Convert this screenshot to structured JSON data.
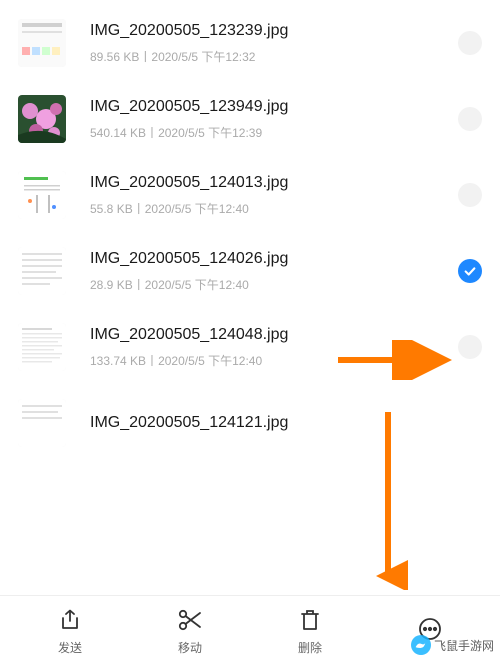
{
  "files": [
    {
      "name": "IMG_20200505_123239.jpg",
      "size": "89.56 KB",
      "date": "2020/5/5 下午12:32",
      "selected": false,
      "thumb": "doc1"
    },
    {
      "name": "IMG_20200505_123949.jpg",
      "size": "540.14 KB",
      "date": "2020/5/5 下午12:39",
      "selected": false,
      "thumb": "photo"
    },
    {
      "name": "IMG_20200505_124013.jpg",
      "size": "55.8 KB",
      "date": "2020/5/5 下午12:40",
      "selected": false,
      "thumb": "doc2"
    },
    {
      "name": "IMG_20200505_124026.jpg",
      "size": "28.9 KB",
      "date": "2020/5/5 下午12:40",
      "selected": true,
      "thumb": "doc3"
    },
    {
      "name": "IMG_20200505_124048.jpg",
      "size": "133.74 KB",
      "date": "2020/5/5 下午12:40",
      "selected": false,
      "thumb": "doc4"
    },
    {
      "name": "IMG_20200505_124121.jpg",
      "size": "",
      "date": "",
      "selected": false,
      "thumb": "doc5"
    }
  ],
  "meta_separator": "丨",
  "actions": {
    "send": "发送",
    "move": "移动",
    "delete": "删除",
    "more": ""
  },
  "watermark_text": "飞鼠手游网"
}
